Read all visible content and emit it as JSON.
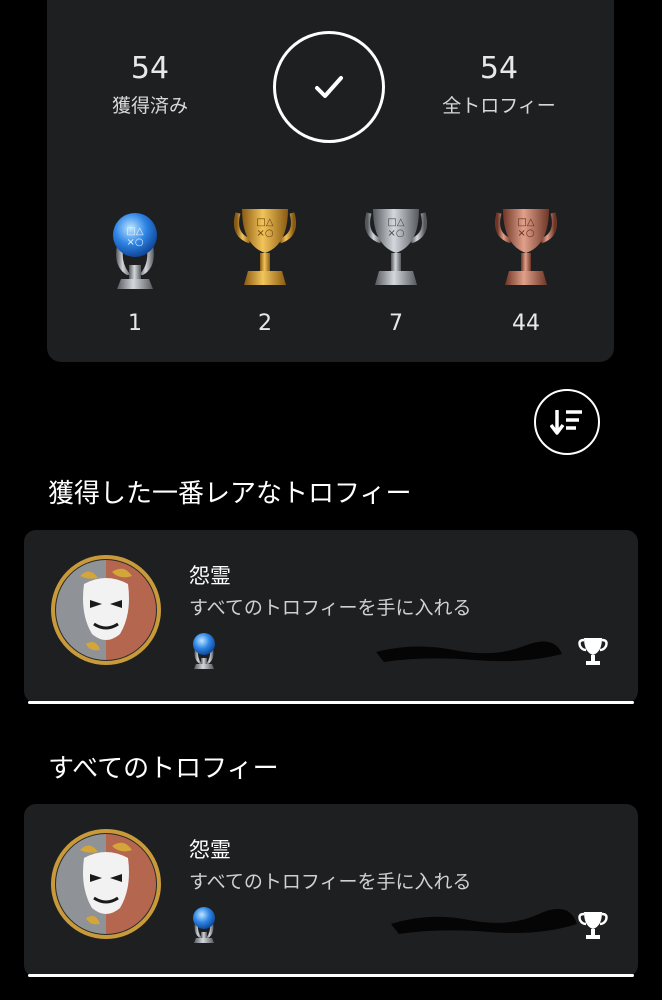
{
  "summary": {
    "earned_count": "54",
    "earned_label": "獲得済み",
    "total_count": "54",
    "total_label": "全トロフィー",
    "trophies": [
      {
        "type": "platinum",
        "count": "1"
      },
      {
        "type": "gold",
        "count": "2"
      },
      {
        "type": "silver",
        "count": "7"
      },
      {
        "type": "bronze",
        "count": "44"
      }
    ]
  },
  "rarest": {
    "title": "獲得した一番レアなトロフィー",
    "item": {
      "name": "怨霊",
      "description": "すべてのトロフィーを手に入れる",
      "grade": "platinum"
    }
  },
  "all": {
    "title": "すべてのトロフィー",
    "item": {
      "name": "怨霊",
      "description": "すべてのトロフィーを手に入れる",
      "grade": "platinum"
    }
  },
  "icons": {
    "check": "check-icon",
    "sort": "sort-icon",
    "trophy": "trophy-icon"
  },
  "colors": {
    "background": "#000000",
    "card": "#1e1f21",
    "gold": "#d8a23a",
    "silver": "#b9bcc0",
    "bronze": "#c0785e",
    "platinum": "#3a8be0"
  }
}
